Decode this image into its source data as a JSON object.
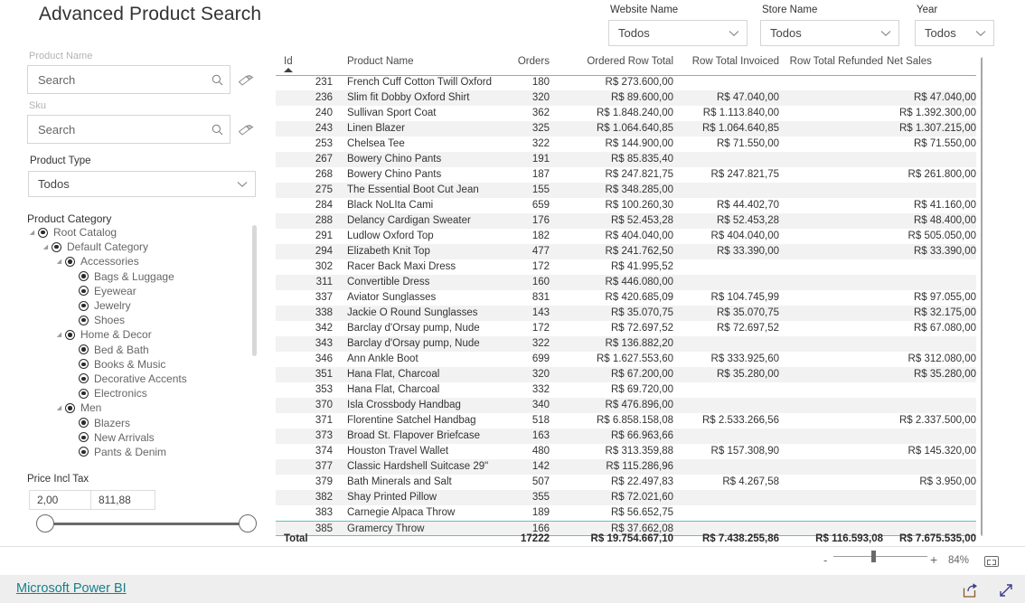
{
  "report": {
    "title": "Advanced Product Search"
  },
  "left_panel": {
    "product_name": {
      "label": "Product Name",
      "placeholder": "Search",
      "value": "",
      "search_icon": "search-icon",
      "clear_icon": "eraser-icon"
    },
    "sku": {
      "label": "Sku",
      "placeholder": "Search",
      "value": "",
      "search_icon": "search-icon",
      "clear_icon": "eraser-icon"
    },
    "product_type": {
      "label": "Product Type",
      "value": "Todos",
      "chevron_icon": "chevron-down-icon"
    },
    "product_category": {
      "label": "Product Category",
      "nodes": [
        {
          "label": "Root Catalog",
          "depth": 0,
          "caret": "◢",
          "expanded": true
        },
        {
          "label": "Default Category",
          "depth": 1,
          "caret": "◢",
          "expanded": true
        },
        {
          "label": "Accessories",
          "depth": 2,
          "caret": "◢",
          "expanded": true
        },
        {
          "label": "Bags & Luggage",
          "depth": 3,
          "caret": "",
          "expanded": false
        },
        {
          "label": "Eyewear",
          "depth": 3,
          "caret": "",
          "expanded": false
        },
        {
          "label": "Jewelry",
          "depth": 3,
          "caret": "",
          "expanded": false
        },
        {
          "label": "Shoes",
          "depth": 3,
          "caret": "",
          "expanded": false
        },
        {
          "label": "Home & Decor",
          "depth": 2,
          "caret": "◢",
          "expanded": true
        },
        {
          "label": "Bed & Bath",
          "depth": 3,
          "caret": "",
          "expanded": false
        },
        {
          "label": "Books & Music",
          "depth": 3,
          "caret": "",
          "expanded": false
        },
        {
          "label": "Decorative Accents",
          "depth": 3,
          "caret": "",
          "expanded": false
        },
        {
          "label": "Electronics",
          "depth": 3,
          "caret": "",
          "expanded": false
        },
        {
          "label": "Men",
          "depth": 2,
          "caret": "◢",
          "expanded": true
        },
        {
          "label": "Blazers",
          "depth": 3,
          "caret": "",
          "expanded": false
        },
        {
          "label": "New Arrivals",
          "depth": 3,
          "caret": "",
          "expanded": false
        },
        {
          "label": "Pants & Denim",
          "depth": 3,
          "caret": "",
          "expanded": false
        }
      ]
    },
    "price_incl_tax": {
      "label": "Price Incl Tax",
      "min_value": "2,00",
      "max_value": "811,88"
    }
  },
  "top_slicers": [
    {
      "label": "Website Name",
      "value": "Todos",
      "chevron_icon": "chevron-down-icon"
    },
    {
      "label": "Store Name",
      "value": "Todos",
      "chevron_icon": "chevron-down-icon"
    },
    {
      "label": "Year",
      "value": "Todos",
      "chevron_icon": "chevron-down-icon"
    }
  ],
  "table": {
    "sort_column": "Id",
    "sort_direction": "ascending",
    "columns": [
      "Id",
      "Product Name",
      "Orders",
      "Ordered Row Total",
      "Row Total Invoiced",
      "Row Total Refunded",
      "Net Sales"
    ],
    "rows": [
      {
        "id": "231",
        "name": "French Cuff Cotton Twill Oxford",
        "orders": "180",
        "ordered": "R$ 273.600,00",
        "invoiced": "",
        "refunded": "",
        "net": ""
      },
      {
        "id": "236",
        "name": "Slim fit Dobby Oxford Shirt",
        "orders": "320",
        "ordered": "R$ 89.600,00",
        "invoiced": "R$ 47.040,00",
        "refunded": "",
        "net": "R$ 47.040,00"
      },
      {
        "id": "240",
        "name": "Sullivan Sport Coat",
        "orders": "362",
        "ordered": "R$ 1.848.240,00",
        "invoiced": "R$ 1.113.840,00",
        "refunded": "",
        "net": "R$ 1.392.300,00"
      },
      {
        "id": "243",
        "name": "Linen Blazer",
        "orders": "325",
        "ordered": "R$ 1.064.640,85",
        "invoiced": "R$ 1.064.640,85",
        "refunded": "",
        "net": "R$ 1.307.215,00"
      },
      {
        "id": "253",
        "name": "Chelsea Tee",
        "orders": "322",
        "ordered": "R$ 144.900,00",
        "invoiced": "R$ 71.550,00",
        "refunded": "",
        "net": "R$ 71.550,00"
      },
      {
        "id": "267",
        "name": "Bowery Chino Pants",
        "orders": "191",
        "ordered": "R$ 85.835,40",
        "invoiced": "",
        "refunded": "",
        "net": ""
      },
      {
        "id": "268",
        "name": "Bowery Chino Pants",
        "orders": "187",
        "ordered": "R$ 247.821,75",
        "invoiced": "R$ 247.821,75",
        "refunded": "",
        "net": "R$ 261.800,00"
      },
      {
        "id": "275",
        "name": "The Essential Boot Cut Jean",
        "orders": "155",
        "ordered": "R$ 348.285,00",
        "invoiced": "",
        "refunded": "",
        "net": ""
      },
      {
        "id": "284",
        "name": "Black NoLIta Cami",
        "orders": "659",
        "ordered": "R$ 100.260,30",
        "invoiced": "R$ 44.402,70",
        "refunded": "",
        "net": "R$ 41.160,00"
      },
      {
        "id": "288",
        "name": "Delancy Cardigan Sweater",
        "orders": "176",
        "ordered": "R$ 52.453,28",
        "invoiced": "R$ 52.453,28",
        "refunded": "",
        "net": "R$ 48.400,00"
      },
      {
        "id": "291",
        "name": "Ludlow Oxford Top",
        "orders": "182",
        "ordered": "R$ 404.040,00",
        "invoiced": "R$ 404.040,00",
        "refunded": "",
        "net": "R$ 505.050,00"
      },
      {
        "id": "294",
        "name": "Elizabeth Knit Top",
        "orders": "477",
        "ordered": "R$ 241.762,50",
        "invoiced": "R$ 33.390,00",
        "refunded": "",
        "net": "R$ 33.390,00"
      },
      {
        "id": "302",
        "name": "Racer Back Maxi Dress",
        "orders": "172",
        "ordered": "R$ 41.995,52",
        "invoiced": "",
        "refunded": "",
        "net": ""
      },
      {
        "id": "311",
        "name": "Convertible Dress",
        "orders": "160",
        "ordered": "R$ 446.080,00",
        "invoiced": "",
        "refunded": "",
        "net": ""
      },
      {
        "id": "337",
        "name": "Aviator Sunglasses",
        "orders": "831",
        "ordered": "R$ 420.685,09",
        "invoiced": "R$ 104.745,99",
        "refunded": "",
        "net": "R$ 97.055,00"
      },
      {
        "id": "338",
        "name": "Jackie O Round Sunglasses",
        "orders": "143",
        "ordered": "R$ 35.070,75",
        "invoiced": "R$ 35.070,75",
        "refunded": "",
        "net": "R$ 32.175,00"
      },
      {
        "id": "342",
        "name": "Barclay d'Orsay pump, Nude",
        "orders": "172",
        "ordered": "R$ 72.697,52",
        "invoiced": "R$ 72.697,52",
        "refunded": "",
        "net": "R$ 67.080,00"
      },
      {
        "id": "343",
        "name": "Barclay d'Orsay pump, Nude",
        "orders": "322",
        "ordered": "R$ 136.882,20",
        "invoiced": "",
        "refunded": "",
        "net": ""
      },
      {
        "id": "346",
        "name": "Ann Ankle Boot",
        "orders": "699",
        "ordered": "R$ 1.627.553,60",
        "invoiced": "R$ 333.925,60",
        "refunded": "",
        "net": "R$ 312.080,00"
      },
      {
        "id": "351",
        "name": "Hana Flat, Charcoal",
        "orders": "320",
        "ordered": "R$ 67.200,00",
        "invoiced": "R$ 35.280,00",
        "refunded": "",
        "net": "R$ 35.280,00"
      },
      {
        "id": "353",
        "name": "Hana Flat, Charcoal",
        "orders": "332",
        "ordered": "R$ 69.720,00",
        "invoiced": "",
        "refunded": "",
        "net": ""
      },
      {
        "id": "370",
        "name": "Isla Crossbody Handbag",
        "orders": "340",
        "ordered": "R$ 476.896,00",
        "invoiced": "",
        "refunded": "",
        "net": ""
      },
      {
        "id": "371",
        "name": "Florentine Satchel Handbag",
        "orders": "518",
        "ordered": "R$ 6.858.158,08",
        "invoiced": "R$ 2.533.266,56",
        "refunded": "",
        "net": "R$ 2.337.500,00"
      },
      {
        "id": "373",
        "name": "Broad St. Flapover Briefcase",
        "orders": "163",
        "ordered": "R$ 66.963,66",
        "invoiced": "",
        "refunded": "",
        "net": ""
      },
      {
        "id": "374",
        "name": "Houston Travel Wallet",
        "orders": "480",
        "ordered": "R$ 313.359,88",
        "invoiced": "R$ 157.308,90",
        "refunded": "",
        "net": "R$ 145.320,00"
      },
      {
        "id": "377",
        "name": "Classic Hardshell Suitcase 29\"",
        "orders": "142",
        "ordered": "R$ 115.286,96",
        "invoiced": "",
        "refunded": "",
        "net": ""
      },
      {
        "id": "379",
        "name": "Bath Minerals and Salt",
        "orders": "507",
        "ordered": "R$ 22.497,83",
        "invoiced": "R$ 4.267,58",
        "refunded": "",
        "net": "R$ 3.950,00"
      },
      {
        "id": "382",
        "name": "Shay Printed Pillow",
        "orders": "355",
        "ordered": "R$ 72.021,60",
        "invoiced": "",
        "refunded": "",
        "net": ""
      },
      {
        "id": "383",
        "name": "Carnegie Alpaca Throw",
        "orders": "189",
        "ordered": "R$ 56.652,75",
        "invoiced": "",
        "refunded": "",
        "net": ""
      },
      {
        "id": "385",
        "name": "Gramercy Throw",
        "orders": "166",
        "ordered": "R$ 37.662,08",
        "invoiced": "",
        "refunded": "",
        "net": "",
        "selected": true
      }
    ],
    "total": {
      "label": "Total",
      "orders": "17222",
      "ordered": "R$ 19.754.667,10",
      "invoiced": "R$ 7.438.255,86",
      "refunded": "R$ 116.593,08",
      "net": "R$ 7.675.535,00"
    }
  },
  "zoom_bar": {
    "minus": "-",
    "plus": "+",
    "percent": "84%",
    "fit_icon": "fit-to-page-icon"
  },
  "footer": {
    "brand": "Microsoft Power BI",
    "share_icon": "share-icon",
    "fullscreen_icon": "fullscreen-icon"
  },
  "colors": {
    "accent_teal": "#4ec9c0",
    "link_teal": "#17808a",
    "row_alt": "#f2f2f2"
  }
}
